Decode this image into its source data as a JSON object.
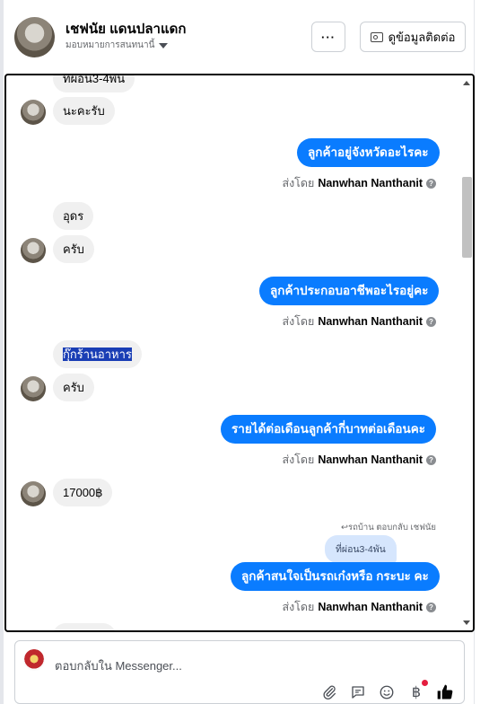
{
  "header": {
    "contact_name": "เชฟนัย แดนปลาแดก",
    "assign_label": "มอบหมายการสนทนานี้",
    "more_label": "···",
    "contact_info_label": "ดูข้อมูลติดต่อ"
  },
  "messages": {
    "m0": "ที่ผ่อน3-4พัน",
    "m1": "นะคะรับ",
    "m2": "ลูกค้าอยู่จังหวัดอะไรคะ",
    "m3": "อุดร",
    "m4": "ครับ",
    "m5": "ลูกค้าประกอบอาชีพอะไรอยู่คะ",
    "m6": "กุ๊กร้านอาหาร",
    "m7": "ครับ",
    "m8": "รายได้ต่อเดือนลูกค้ากี่บาทต่อเดือนคะ",
    "m9": "17000฿",
    "m10": "ลูกค้าสนใจเป็นรถเก๋งหรือ กระบะ คะ"
  },
  "sent_by": {
    "prefix": "ส่งโดย",
    "agent": "Nanwhan Nanthanit"
  },
  "reply_context": {
    "label": "↩รถบ้าน ตอบกลับ เชฟนัย",
    "quoted": "ที่ผ่อน3-4พัน"
  },
  "composer": {
    "placeholder": "ตอบกลับใน Messenger...",
    "baht_symbol": "฿"
  },
  "colors": {
    "outgoing_bubble": "#0a7cff",
    "incoming_bubble": "#f0f0f0",
    "highlight": "#1a3eb5",
    "notification_dot": "#e41e3f"
  }
}
